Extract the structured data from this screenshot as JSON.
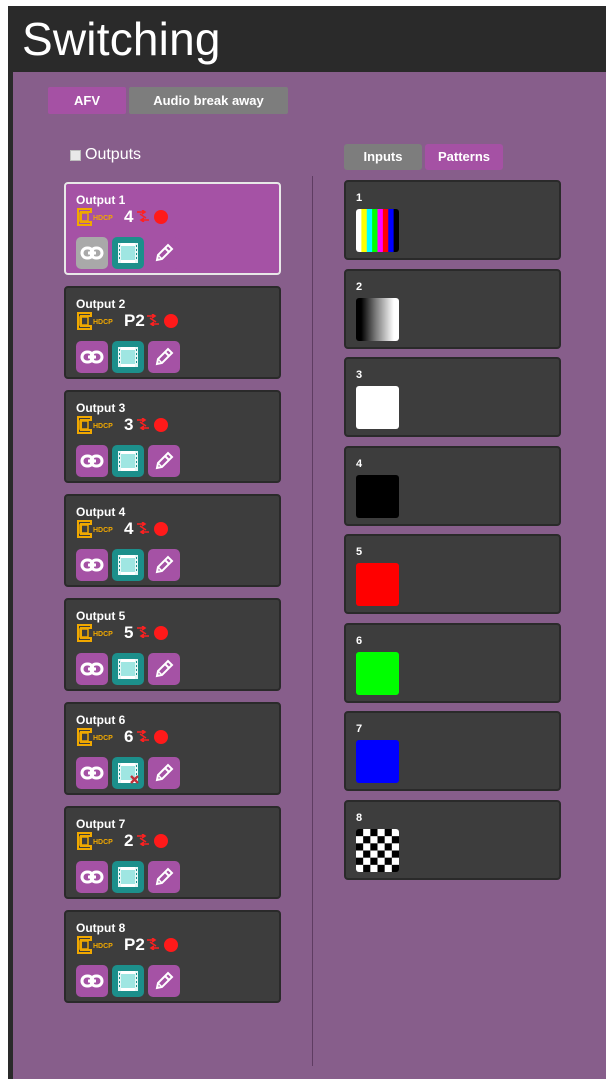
{
  "header": {
    "title": "Switching"
  },
  "mode_tabs": {
    "afv": "AFV",
    "audio_break_away": "Audio break away",
    "selected": "AFV"
  },
  "outputs_toggle": {
    "label": "Outputs",
    "checked": false
  },
  "list_tabs": {
    "inputs": "Inputs",
    "patterns": "Patterns",
    "selected": "Patterns"
  },
  "outputs": [
    {
      "name": "Output 1",
      "source": "4",
      "selected": true,
      "video_disabled": false
    },
    {
      "name": "Output 2",
      "source": "P2",
      "selected": false,
      "video_disabled": false
    },
    {
      "name": "Output 3",
      "source": "3",
      "selected": false,
      "video_disabled": false
    },
    {
      "name": "Output 4",
      "source": "4",
      "selected": false,
      "video_disabled": false
    },
    {
      "name": "Output 5",
      "source": "5",
      "selected": false,
      "video_disabled": false
    },
    {
      "name": "Output 6",
      "source": "6",
      "selected": false,
      "video_disabled": true
    },
    {
      "name": "Output 7",
      "source": "2",
      "selected": false,
      "video_disabled": false
    },
    {
      "name": "Output 8",
      "source": "P2",
      "selected": false,
      "video_disabled": false
    }
  ],
  "patterns": [
    {
      "number": "1",
      "kind": "color-bars"
    },
    {
      "number": "2",
      "kind": "gradient"
    },
    {
      "number": "3",
      "kind": "solid",
      "color": "#ffffff"
    },
    {
      "number": "4",
      "kind": "solid",
      "color": "#000000"
    },
    {
      "number": "5",
      "kind": "solid",
      "color": "#ff0000"
    },
    {
      "number": "6",
      "kind": "solid",
      "color": "#00ff00"
    },
    {
      "number": "7",
      "kind": "solid",
      "color": "#0000ff"
    },
    {
      "number": "8",
      "kind": "checkerboard"
    }
  ],
  "icons": {
    "hdcp": "hdcp-icon",
    "swap": "swap-arrows-icon",
    "record": "red-dot-icon",
    "link": "link-icon",
    "video": "film-icon",
    "edit": "pencil-icon"
  },
  "colors": {
    "background": "#875e8b",
    "header": "#2a2a2a",
    "accent": "#a552a5",
    "inactive_tab": "#7d7d7d",
    "card": "#3d3d3d",
    "video_button": "#1c8f8b",
    "hdcp": "#f0a800",
    "alert": "#ff1a1a"
  }
}
